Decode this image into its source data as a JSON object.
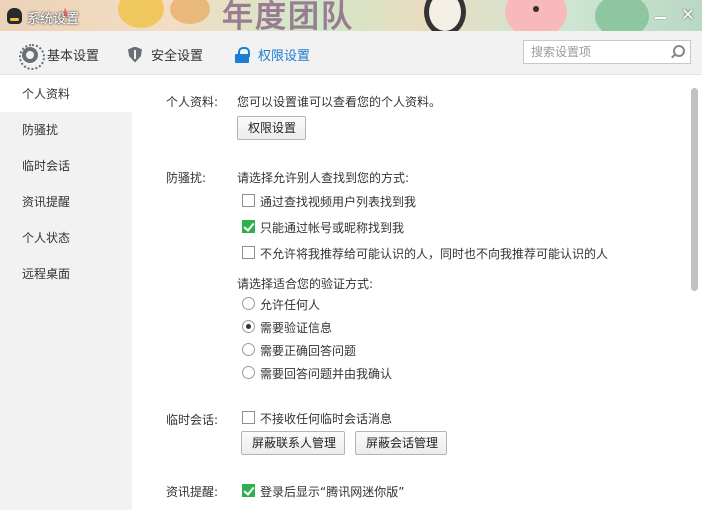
{
  "window": {
    "title": "系统设置",
    "banner_text": "年度团队",
    "minimize_glyph": "",
    "close_glyph": "✕"
  },
  "toolbar": {
    "tabs": [
      {
        "label": "基本设置",
        "icon": "gear-icon"
      },
      {
        "label": "安全设置",
        "icon": "shield-icon"
      },
      {
        "label": "权限设置",
        "icon": "lock-icon",
        "active": true
      }
    ],
    "search_placeholder": "搜索设置项"
  },
  "sidebar": {
    "items": [
      {
        "label": "个人资料",
        "active": true
      },
      {
        "label": "防骚扰"
      },
      {
        "label": "临时会话"
      },
      {
        "label": "资讯提醒"
      },
      {
        "label": "个人状态"
      },
      {
        "label": "远程桌面"
      }
    ]
  },
  "main": {
    "profile": {
      "label": "个人资料:",
      "desc": "您可以设置谁可以查看您的个人资料。",
      "button": "权限设置"
    },
    "anti_harass": {
      "label": "防骚扰:",
      "find_prompt": "请选择允许别人查找到您的方式:",
      "options": [
        {
          "label": "通过查找视频用户列表找到我",
          "checked": false
        },
        {
          "label": "只能通过帐号或昵称找到我",
          "checked": true
        },
        {
          "label": "不允许将我推荐给可能认识的人，同时也不向我推荐可能认识的人",
          "checked": false
        }
      ],
      "verify_prompt": "请选择适合您的验证方式:",
      "verify_options": [
        {
          "label": "允许任何人",
          "selected": false
        },
        {
          "label": "需要验证信息",
          "selected": true
        },
        {
          "label": "需要正确回答问题",
          "selected": false
        },
        {
          "label": "需要回答问题并由我确认",
          "selected": false
        }
      ]
    },
    "temp_session": {
      "label": "临时会话:",
      "option": {
        "label": "不接收任何临时会话消息",
        "checked": false
      },
      "button_contacts": "屏蔽联系人管理",
      "button_sessions": "屏蔽会话管理"
    },
    "news_alert": {
      "label": "资讯提醒:",
      "option": {
        "label": "登录后显示“腾讯网迷你版”",
        "checked": true
      }
    }
  },
  "colors": {
    "accent": "#1a7fd0",
    "check_green": "#2eae4f",
    "sidebar_bg": "#f2f2f2"
  }
}
